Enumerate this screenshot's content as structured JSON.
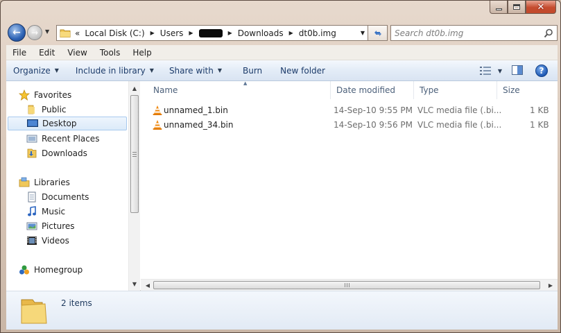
{
  "window": {
    "caption": {
      "minimize": "minimize",
      "maximize": "maximize",
      "close": "close"
    }
  },
  "address": {
    "chevron": "«",
    "crumbs": [
      "Local Disk (C:)",
      "Users",
      "",
      "Downloads",
      "dt0b.img"
    ]
  },
  "search": {
    "placeholder": "Search dt0b.img"
  },
  "menu": [
    "File",
    "Edit",
    "View",
    "Tools",
    "Help"
  ],
  "toolbar": {
    "organize": "Organize",
    "include_in_library": "Include in library",
    "share_with": "Share with",
    "burn": "Burn",
    "new_folder": "New folder",
    "help": "?"
  },
  "nav": {
    "favorites": "Favorites",
    "public": "Public",
    "desktop": "Desktop",
    "recent_places": "Recent Places",
    "downloads": "Downloads",
    "libraries": "Libraries",
    "documents": "Documents",
    "music": "Music",
    "pictures": "Pictures",
    "videos": "Videos",
    "homegroup": "Homegroup"
  },
  "columns": {
    "name": "Name",
    "date_modified": "Date modified",
    "type": "Type",
    "size": "Size"
  },
  "files": [
    {
      "name": "unnamed_1.bin",
      "date": "14-Sep-10 9:55 PM",
      "type": "VLC media file (.bi...",
      "size": "1 KB"
    },
    {
      "name": "unnamed_34.bin",
      "date": "14-Sep-10 9:56 PM",
      "type": "VLC media file (.bi...",
      "size": "1 KB"
    }
  ],
  "status": {
    "item_count": "2 items"
  },
  "colors": {
    "accent": "#1c3b6a",
    "selection": "#dbeaf9",
    "frame": "#d6c4b5"
  }
}
